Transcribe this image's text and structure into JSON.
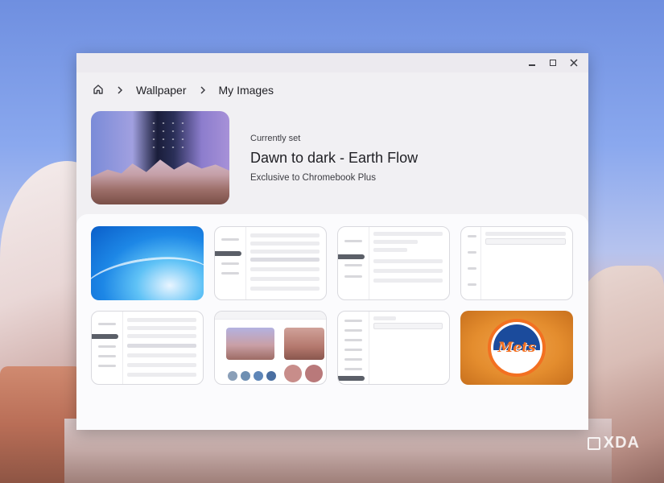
{
  "window": {
    "controls": [
      "minimize",
      "maximize",
      "close"
    ]
  },
  "breadcrumb": {
    "home_icon": "home-icon",
    "items": [
      "Wallpaper",
      "My Images"
    ],
    "separator_icon": "chevron-right-icon"
  },
  "current": {
    "label": "Currently set",
    "title": "Dawn to dark - Earth Flow",
    "subtitle": "Exclusive to Chromebook Plus"
  },
  "grid": {
    "tiles": [
      "blue-wave-wallpaper",
      "settings-screenshot",
      "settings-screenshot",
      "settings-screenshot",
      "settings-screenshot",
      "wallpaper-app-screenshot",
      "settings-screenshot",
      "mets-logo"
    ]
  },
  "mets": {
    "text": "Mets"
  },
  "watermark": {
    "text": "XDA"
  }
}
